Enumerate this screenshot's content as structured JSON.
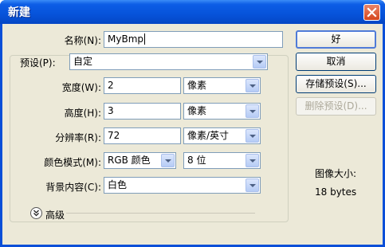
{
  "window": {
    "title": "新建",
    "close_icon": "close-icon"
  },
  "name_field": {
    "label": "名称(N):",
    "value": "MyBmp"
  },
  "preset": {
    "label": "预设(P):",
    "value": "自定"
  },
  "width": {
    "label": "宽度(W):",
    "value": "2",
    "unit": "像素"
  },
  "height": {
    "label": "高度(H):",
    "value": "3",
    "unit": "像素"
  },
  "resolution": {
    "label": "分辨率(R):",
    "value": "72",
    "unit": "像素/英寸"
  },
  "color_mode": {
    "label": "颜色模式(M):",
    "value": "RGB 颜色",
    "depth": "8 位"
  },
  "background": {
    "label": "背景内容(C):",
    "value": "白色"
  },
  "advanced": {
    "label": "高级"
  },
  "buttons": {
    "ok": "好",
    "cancel": "取消",
    "save_preset": "存储预设(S)...",
    "delete_preset": "删除预设(D)..."
  },
  "image_size": {
    "label": "图像大小:",
    "value": "18 bytes"
  }
}
